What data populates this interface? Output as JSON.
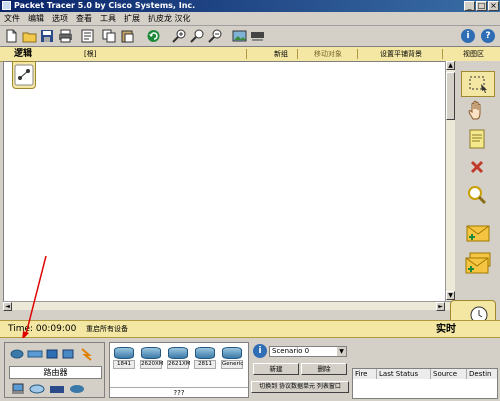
{
  "window": {
    "title": "Packet Tracer 5.0 by Cisco Systems, Inc.",
    "buttons": {
      "minimize": "_",
      "maximize": "□",
      "close": "×"
    }
  },
  "menu": [
    "文件",
    "编辑",
    "选项",
    "查看",
    "工具",
    "扩展",
    "扒皮龙 汉化"
  ],
  "toolbar": {
    "icons": [
      "new-file-icon",
      "open-folder-icon",
      "save-icon",
      "print-icon",
      "activity-wizard-icon",
      "copy-icon",
      "paste-icon",
      "undo-icon",
      "zoom-in-icon",
      "zoom-reset-icon",
      "zoom-out-icon",
      "drawing-palette-icon",
      "custom-device-icon"
    ],
    "info_label": "i",
    "help_label": "?"
  },
  "workspace_bar": {
    "mode": "逻辑",
    "root": "[根]",
    "new_cluster": "新组",
    "move_object": "移动对象",
    "set_background": "设置平铺背景",
    "viewport": "视图区"
  },
  "right_tools": [
    "select-icon",
    "move-hand-icon",
    "note-icon",
    "delete-icon",
    "inspect-icon",
    "add-simple-pdu-icon",
    "add-complex-pdu-icon"
  ],
  "status": {
    "time": "Time: 00:09:00",
    "power_cycle": "重启所有设备",
    "realtime": "实时"
  },
  "device_palette": {
    "category_label": "路由器",
    "devices": [
      "1841",
      "2620XM",
      "2621XM",
      "2811",
      "Generic"
    ],
    "selected_name": "???"
  },
  "scenario": {
    "info": "i",
    "selected": "Scenario 0",
    "new_label": "新建",
    "delete_label": "删除",
    "toggle_pdu_label": "切换到 协议数据单元 列表窗口"
  },
  "event_list": {
    "columns": [
      "Fire",
      "Last Status",
      "Source",
      "Destin"
    ]
  },
  "colors": {
    "accent_yellow": "#f3e7a3",
    "titlebar": "#0a246a",
    "help_blue": "#2f6db5"
  }
}
